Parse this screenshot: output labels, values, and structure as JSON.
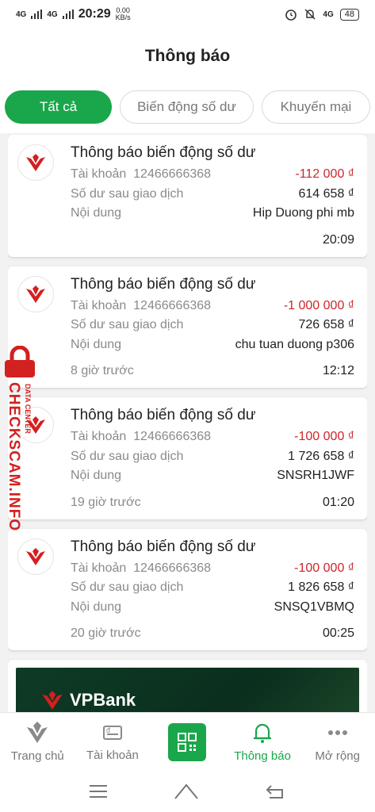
{
  "status_bar": {
    "net1": "4G",
    "net2": "4G",
    "time": "20:29",
    "speed_value": "0.00",
    "speed_unit": "KB/s",
    "right_net": "4G",
    "battery": "48"
  },
  "header": {
    "title": "Thông báo"
  },
  "tabs": [
    {
      "label": "Tất cả",
      "active": true
    },
    {
      "label": "Biến động số dư",
      "active": false
    },
    {
      "label": "Khuyến mại",
      "active": false
    }
  ],
  "labels": {
    "account": "Tài khoản",
    "balance_after": "Số dư sau giao dịch",
    "content": "Nội dung"
  },
  "notifications": [
    {
      "title": "Thông báo biến động số dư",
      "account": "12466666368",
      "amount": "-112 000 ₫",
      "balance": "614 658 ₫",
      "content": "Hip Duong phi mb",
      "ago": "",
      "time": "20:09"
    },
    {
      "title": "Thông báo biến động số dư",
      "account": "12466666368",
      "amount": "-1 000 000 ₫",
      "balance": "726 658 ₫",
      "content": "chu tuan duong p306",
      "ago": "8 giờ trước",
      "time": "12:12"
    },
    {
      "title": "Thông báo biến động số dư",
      "account": "12466666368",
      "amount": "-100 000 ₫",
      "balance": "1 726 658 ₫",
      "content": "SNSRH1JWF",
      "ago": "19 giờ trước",
      "time": "01:20"
    },
    {
      "title": "Thông báo biến động số dư",
      "account": "12466666368",
      "amount": "-100 000 ₫",
      "balance": "1 826 658 ₫",
      "content": "SNSQ1VBMQ",
      "ago": "20 giờ trước",
      "time": "00:25"
    }
  ],
  "banner": {
    "brand": "VPBank"
  },
  "bottom_nav": [
    {
      "label": "Trang chủ",
      "icon": "home-icon",
      "active": false
    },
    {
      "label": "Tài khoản",
      "icon": "account-card-icon",
      "active": false
    },
    {
      "label": "",
      "icon": "qr-scan-icon",
      "active": false
    },
    {
      "label": "Thông báo",
      "icon": "bell-icon",
      "active": true
    },
    {
      "label": "Mở rộng",
      "icon": "more-dots-icon",
      "active": false
    }
  ],
  "watermark": {
    "text": "CHECKSCAM.INFO",
    "sub": "DATA CENTER"
  },
  "colors": {
    "accent": "#1aa64a",
    "negative": "#d0252a",
    "brand_red": "#d32020"
  }
}
